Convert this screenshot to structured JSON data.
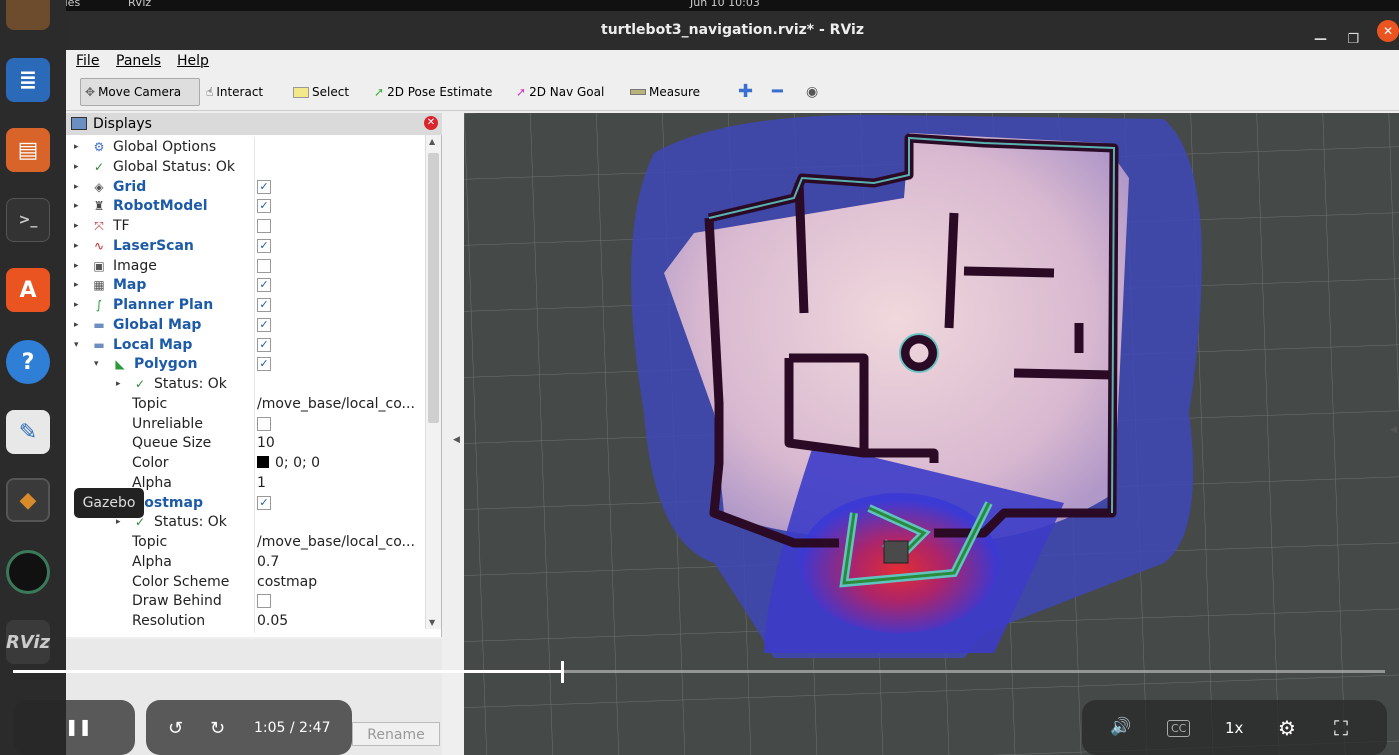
{
  "os": {
    "activities": "Activities",
    "app_name": "RViz",
    "clock": "Jun 10  10:03",
    "tooltip": "Gazebo"
  },
  "window": {
    "title": "turtlebot3_navigation.rviz* - RViz"
  },
  "menu": {
    "file": "File",
    "panels": "Panels",
    "help": "Help"
  },
  "toolbar": {
    "move_camera": "Move Camera",
    "interact": "Interact",
    "select": "Select",
    "pose_estimate": "2D Pose Estimate",
    "nav_goal": "2D Nav Goal",
    "measure": "Measure"
  },
  "displays": {
    "title": "Displays",
    "rows": [
      {
        "label": "Global Options"
      },
      {
        "label": "Global Status: Ok"
      },
      {
        "label": "Grid",
        "checked": true
      },
      {
        "label": "RobotModel",
        "checked": true
      },
      {
        "label": "TF",
        "checked": false
      },
      {
        "label": "LaserScan",
        "checked": true
      },
      {
        "label": "Image",
        "checked": false
      },
      {
        "label": "Map",
        "checked": true
      },
      {
        "label": "Planner Plan",
        "checked": true
      },
      {
        "label": "Global Map",
        "checked": true
      },
      {
        "label": "Local Map",
        "checked": true
      },
      {
        "label": "Polygon",
        "checked": true
      },
      {
        "label": "Status: Ok"
      },
      {
        "label": "Topic",
        "value": "/move_base/local_co..."
      },
      {
        "label": "Unreliable",
        "checked": false
      },
      {
        "label": "Queue Size",
        "value": "10"
      },
      {
        "label": "Color",
        "value": "0; 0; 0",
        "swatch": "#000000"
      },
      {
        "label": "Alpha",
        "value": "1"
      },
      {
        "label": "Costmap",
        "checked": true
      },
      {
        "label": "Status: Ok"
      },
      {
        "label": "Topic",
        "value": "/move_base/local_co..."
      },
      {
        "label": "Alpha",
        "value": "0.7"
      },
      {
        "label": "Color Scheme",
        "value": "costmap"
      },
      {
        "label": "Draw Behind",
        "checked": false
      },
      {
        "label": "Resolution",
        "value": "0.05"
      }
    ],
    "rename_label": "Rename"
  },
  "video": {
    "time": "1:05 / 2:47",
    "speed": "1x",
    "progress": 0.4
  },
  "colors": {
    "accent": "#e95420",
    "link": "#1d5ba8",
    "costmap_blue": "#3b3fd9",
    "costmap_red": "#e02020"
  }
}
